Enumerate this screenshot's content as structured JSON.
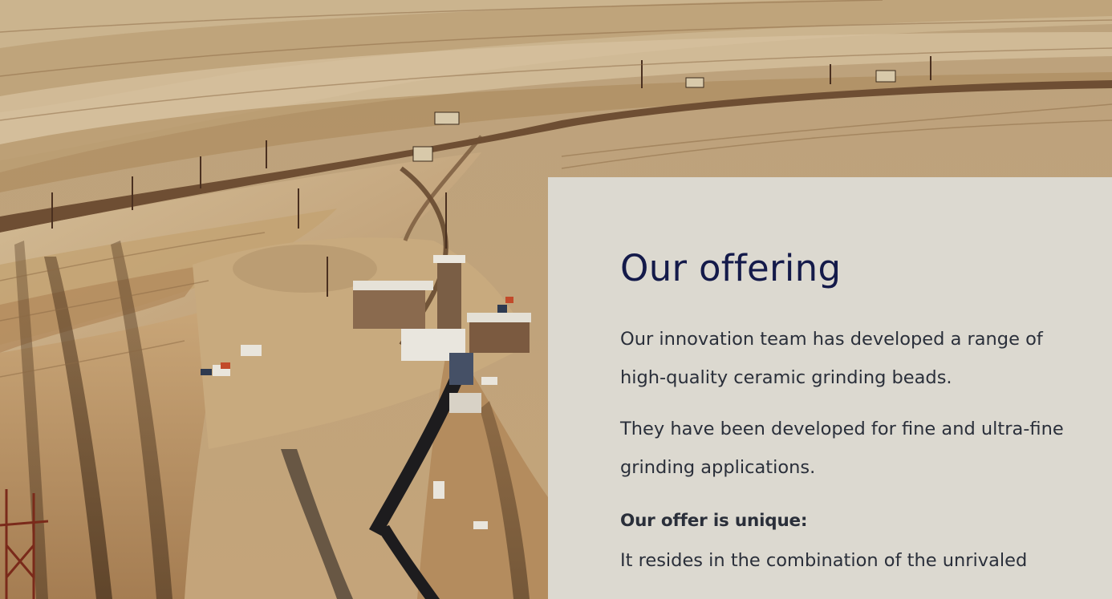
{
  "hero_image": {
    "subject": "open-pit-mine-photo"
  },
  "offering": {
    "title": "Our offering",
    "paragraph_1": "Our innovation team has developed a range of high-quality ceramic grinding beads.",
    "paragraph_2": "They have been developed for fine and ultra-fine grinding applications.",
    "offer_heading": "Our offer is unique:",
    "offer_text": "It resides in the combination of the unrivaled"
  },
  "colors": {
    "panel_background": "#dcd9d0",
    "title_color": "#141a4a",
    "body_text_color": "#2a2f3a"
  }
}
